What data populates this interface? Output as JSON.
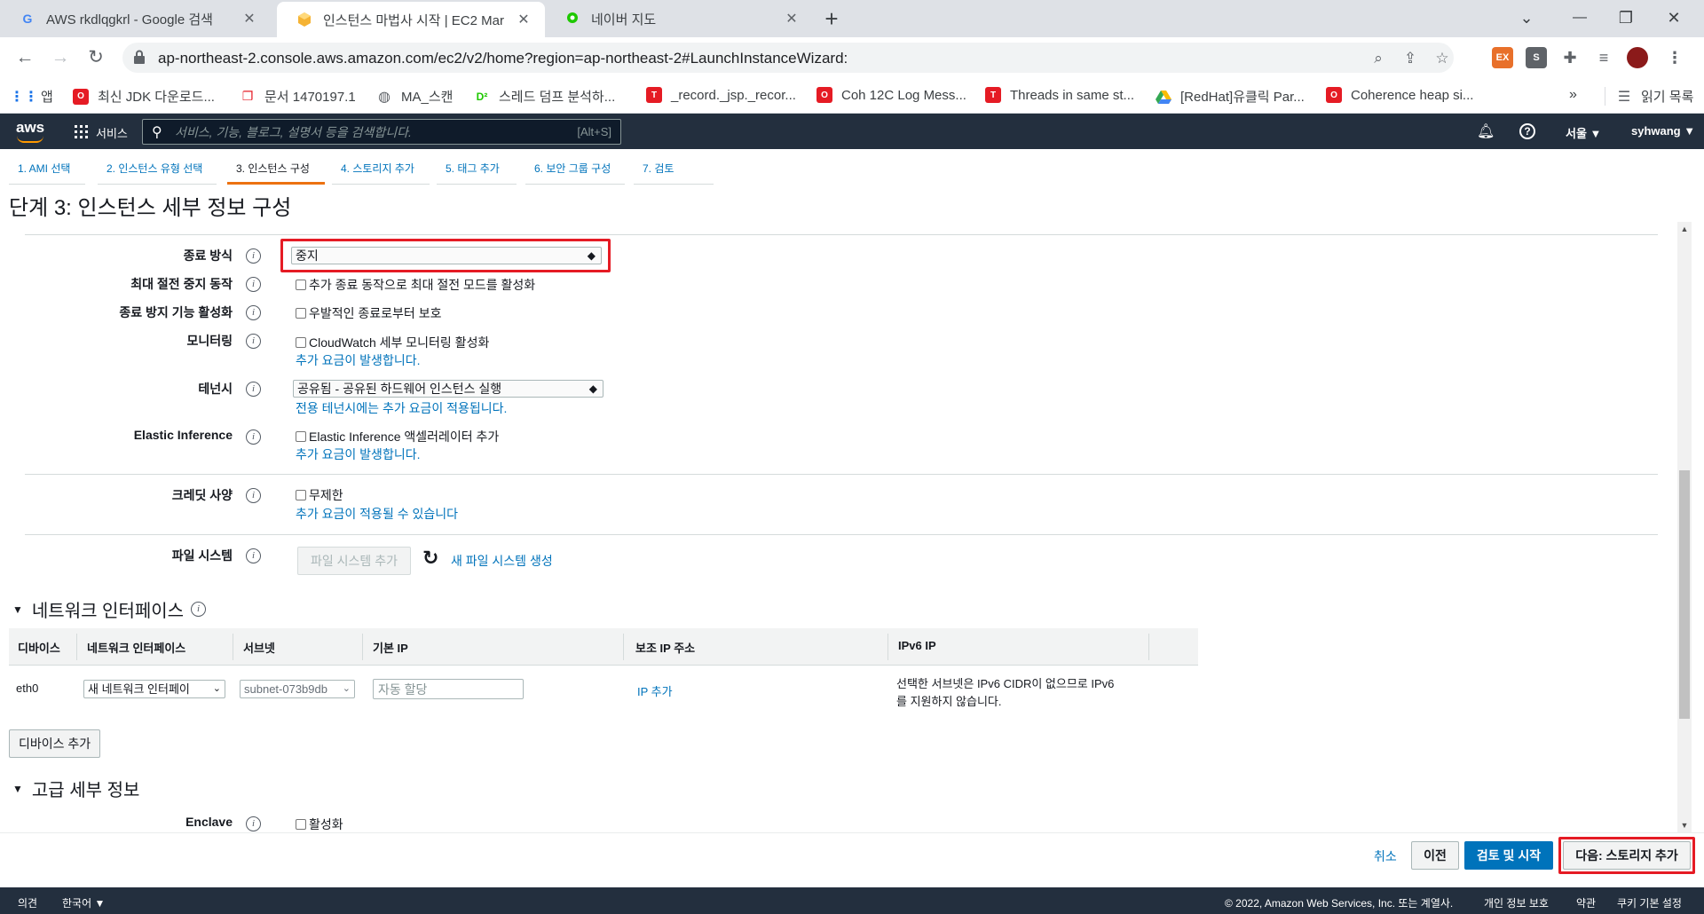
{
  "browser": {
    "tabs": [
      {
        "title": "AWS rkdlqgkrl - Google 검색",
        "icon": "google-icon"
      },
      {
        "title": "인스턴스 마법사 시작 | EC2 Mar",
        "icon": "aws-box-icon"
      },
      {
        "title": "네이버 지도",
        "icon": "naver-map-icon"
      }
    ],
    "url": "ap-northeast-2.console.aws.amazon.com/ec2/v2/home?region=ap-northeast-2#LaunchInstanceWizard:",
    "ext_labels": [
      "EX",
      "S"
    ],
    "bookmarks": [
      "앱",
      "최신 JDK 다운로드...",
      "문서 1470197.1",
      "MA_스캔",
      "스레드 덤프 분석하...",
      "_record._jsp._recor...",
      "Coh 12C Log Mess...",
      "Threads in same st...",
      "[RedHat]유클릭 Par...",
      "Coherence heap si..."
    ],
    "bookmarks_more": "»",
    "reading_list": "읽기 목록"
  },
  "aws": {
    "logo": "aws",
    "services": "서비스",
    "search_placeholder": "서비스, 기능, 블로그, 설명서 등을 검색합니다.",
    "search_shortcut": "[Alt+S]",
    "region": "서울 ▼",
    "user": "syhwang ▼"
  },
  "steps": [
    "1. AMI 선택",
    "2. 인스턴스 유형 선택",
    "3. 인스턴스 구성",
    "4. 스토리지 추가",
    "5. 태그 추가",
    "6. 보안 그룹 구성",
    "7. 검토"
  ],
  "page_title": "단계 3: 인스턴스 세부 정보 구성",
  "form": {
    "shutdown_label": "종료 방식",
    "shutdown_value": "중지",
    "hibernate_label": "최대 절전 중지 동작",
    "hibernate_option": "추가 종료 동작으로 최대 절전 모드를 활성화",
    "termination_label": "종료 방지 기능 활성화",
    "termination_option": "우발적인 종료로부터 보호",
    "monitoring_label": "모니터링",
    "monitoring_option": "CloudWatch 세부 모니터링 활성화",
    "monitoring_note": "추가 요금이 발생합니다.",
    "tenancy_label": "테넌시",
    "tenancy_value": "공유됨 - 공유된 하드웨어 인스턴스 실행",
    "tenancy_note": "전용 테넌시에는 추가 요금이 적용됩니다.",
    "ei_label": "Elastic Inference",
    "ei_option": "Elastic Inference 액셀러레이터 추가",
    "ei_note": "추가 요금이 발생합니다.",
    "credit_label": "크레딧 사양",
    "credit_option": "무제한",
    "credit_note": "추가 요금이 적용될 수 있습니다",
    "fs_label": "파일 시스템",
    "fs_add": "파일 시스템 추가",
    "fs_new": "새 파일 시스템 생성"
  },
  "network": {
    "title": "네트워크 인터페이스",
    "headers": [
      "디바이스",
      "네트워크 인터페이스",
      "서브넷",
      "기본 IP",
      "보조 IP 주소",
      "IPv6 IP"
    ],
    "row": {
      "device": "eth0",
      "interface": "새 네트워크 인터페이",
      "subnet": "subnet-073b9db",
      "ip_placeholder": "자동 할당",
      "add_ip": "IP 추가",
      "ipv6_line1": "선택한 서브넷은 IPv6 CIDR이 없으므로 IPv6",
      "ipv6_line2": "를 지원하지 않습니다."
    },
    "add_device": "디바이스 추가"
  },
  "advanced": {
    "title": "고급 세부 정보",
    "enclave_label": "Enclave",
    "enclave_option": "활성화"
  },
  "actions": {
    "cancel": "취소",
    "previous": "이전",
    "review": "검토 및 시작",
    "next": "다음: 스토리지 추가"
  },
  "footer": {
    "feedback": "의견",
    "language": "한국어 ▼",
    "copyright": "© 2022, Amazon Web Services, Inc. 또는 계열사.",
    "privacy": "개인 정보 보호",
    "terms": "약관",
    "cookies": "쿠키 기본 설정"
  },
  "colors": {
    "aws_nav": "#232f3e",
    "aws_orange": "#ff9900",
    "link": "#0073bb",
    "highlight_red": "#e51b24"
  }
}
